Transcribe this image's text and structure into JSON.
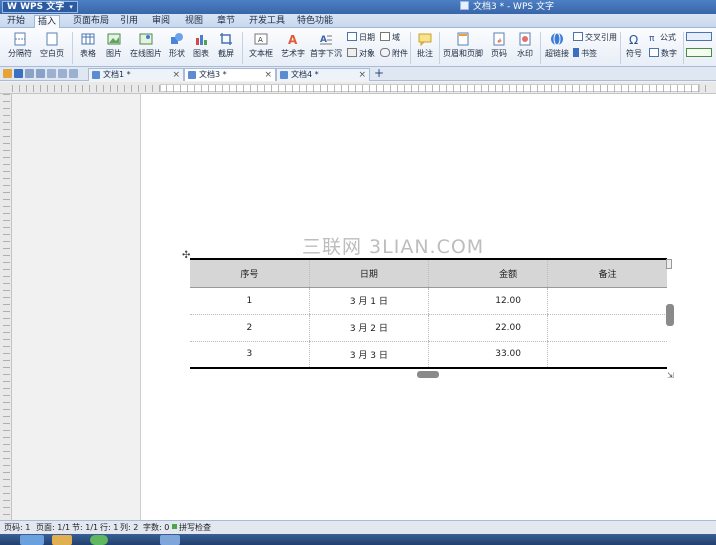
{
  "app": {
    "name": "WPS 文字",
    "window_title": "文档3 * - WPS 文字"
  },
  "menu": [
    "开始",
    "插入",
    "页面布局",
    "引用",
    "审阅",
    "视图",
    "章节",
    "开发工具",
    "特色功能"
  ],
  "ribbon": {
    "page_break": "分隔符",
    "blank_page": "空白页",
    "table": "表格",
    "picture": "图片",
    "online_picture": "在线图片",
    "shapes": "形状",
    "chart": "图表",
    "screenshot": "截屏",
    "textbox": "文本框",
    "wordart": "艺术字",
    "dropcap": "首字下沉",
    "date": "日期",
    "field": "域",
    "object": "对象",
    "attachment": "附件",
    "comment": "批注",
    "header_footer": "页眉和页脚",
    "page_number": "页码",
    "watermark": "水印",
    "hyperlink": "超链接",
    "cross_ref": "交叉引用",
    "bookmark": "书签",
    "symbol": "符号",
    "formula": "公式",
    "number": "数字"
  },
  "tabs": [
    {
      "label": "文档1 *"
    },
    {
      "label": "文档3 *"
    },
    {
      "label": "文档4 *"
    }
  ],
  "table": {
    "headers": [
      "序号",
      "日期",
      "金额",
      "备注"
    ],
    "rows": [
      [
        "1",
        "3 月 1 日",
        "12.00",
        ""
      ],
      [
        "2",
        "3 月 2 日",
        "22.00",
        ""
      ],
      [
        "3",
        "3 月 3 日",
        "33.00",
        ""
      ]
    ]
  },
  "watermark_text": "三联网 3LIAN.COM",
  "status": {
    "page": "页码: 1",
    "pages": "页面: 1/1",
    "section": "节: 1/1",
    "row": "行: 1",
    "col": "列: 2",
    "words": "字数: 0",
    "spell": "拼写检查"
  },
  "icons": {
    "add_tab": "+",
    "close": "×",
    "table_move": "✣",
    "resize": "⇲"
  },
  "colors": {
    "title_blue": "#3866a8",
    "header_fill": "#d6d6d6",
    "spell_ok": "#4aa84a"
  }
}
